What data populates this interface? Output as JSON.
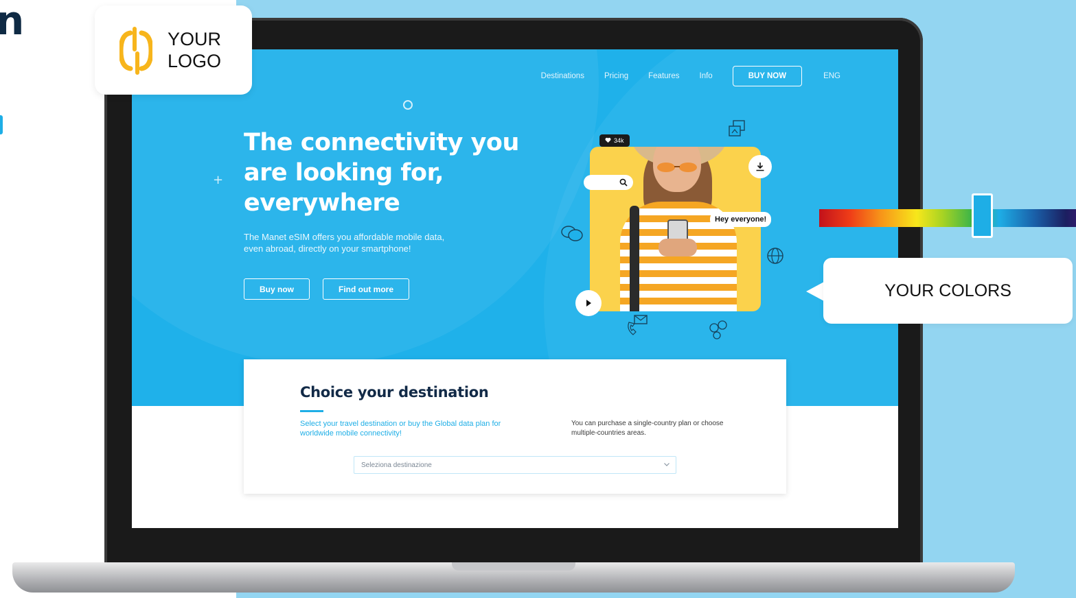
{
  "logo": {
    "line1": "YOUR",
    "line2": "LOGO",
    "icon": "logo-mark-icon",
    "accent": "#f7b51c"
  },
  "nav": {
    "items": [
      "Destinations",
      "Pricing",
      "Features",
      "Info"
    ],
    "buy_now": "BUY NOW",
    "language": "ENG"
  },
  "hero": {
    "title_line1": "The connectivity you",
    "title_line2": "are looking for,",
    "title_line3": "everywhere",
    "description": "The Manet eSIM offers you affordable mobile data, even abroad, directly on your smartphone!",
    "buy_now_label": "Buy now",
    "find_out_label": "Find out more"
  },
  "image_overlay": {
    "likes": "34k",
    "speech": "Hey everyone!",
    "icons": [
      "heart-icon",
      "search-icon",
      "download-icon",
      "play-icon",
      "gallery-icon",
      "chat-icon",
      "globe-icon",
      "mail-phone-icon",
      "social-icon"
    ]
  },
  "destination": {
    "title": "Choice your destination",
    "subtitle": "Select your travel destination or buy the Global data plan for worldwide mobile connectivity!",
    "info": "You can purchase a single-country plan or choose multiple-countries areas.",
    "select_placeholder": "Seleziona destinazione"
  },
  "callout": {
    "text": "YOUR COLORS"
  },
  "colors": {
    "brand": "#1fb1ea",
    "navy": "#122a47",
    "yellow": "#fbd24c",
    "background": "#93d5f1"
  }
}
